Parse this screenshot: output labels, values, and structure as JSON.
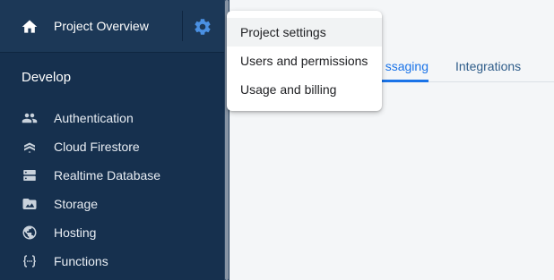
{
  "project": {
    "title": "Project Overview"
  },
  "sidebar": {
    "section_title": "Develop",
    "items": [
      {
        "label": "Authentication",
        "icon": "people-icon"
      },
      {
        "label": "Cloud Firestore",
        "icon": "firestore-icon"
      },
      {
        "label": "Realtime Database",
        "icon": "database-icon"
      },
      {
        "label": "Storage",
        "icon": "folder-image-icon"
      },
      {
        "label": "Hosting",
        "icon": "globe-icon"
      },
      {
        "label": "Functions",
        "icon": "functions-icon"
      }
    ]
  },
  "tabs": [
    {
      "label": "Cloud Messaging",
      "visible_text": "ssaging",
      "active": true
    },
    {
      "label": "Integrations",
      "active": false
    }
  ],
  "menu": {
    "items": [
      {
        "label": "Project settings",
        "highlighted": true
      },
      {
        "label": "Users and permissions",
        "highlighted": false
      },
      {
        "label": "Usage and billing",
        "highlighted": false
      }
    ]
  },
  "colors": {
    "sidebar_bg": "#16304e",
    "project_bar_bg": "#1c3857",
    "accent": "#1a73e8",
    "gear": "#4a90e2",
    "main_bg": "#f4f6f8"
  }
}
